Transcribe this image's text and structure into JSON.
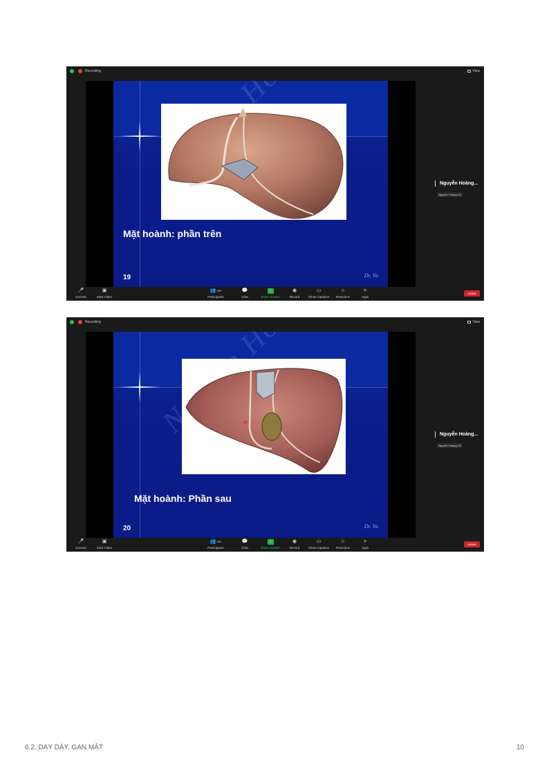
{
  "zoom_windows": [
    {
      "status": {
        "recording_label": "Recording",
        "view_label": "View"
      },
      "slide": {
        "title": "Mặt hoành: phần trên",
        "number": "19",
        "signature": "Dr. Vu",
        "watermark": "Nguyễn Hoàng Vũ"
      },
      "participant": {
        "name": "Nguyễn Hoàng...",
        "tag": "Nguyễn Hoàng Vũ"
      },
      "toolbar": {
        "unmute": "Unmute",
        "start_video": "Start Video",
        "participants": "Participants",
        "participants_count": "259",
        "chat": "Chat",
        "share_screen": "Share Screen",
        "record": "Record",
        "show_captions": "Show Captions",
        "reactions": "Reactions",
        "apps": "Apps",
        "leave": "Leave"
      }
    },
    {
      "status": {
        "recording_label": "Recording",
        "view_label": "View"
      },
      "slide": {
        "title": "Mặt hoành: Phần sau",
        "number": "20",
        "signature": "Dr. Vu",
        "watermark": "Nguyễn Hoàng Vũ"
      },
      "participant": {
        "name": "Nguyễn Hoàng...",
        "tag": "Nguyễn Hoàng Vũ"
      },
      "toolbar": {
        "unmute": "Unmute",
        "start_video": "Start Video",
        "participants": "Participants",
        "participants_count": "259",
        "chat": "Chat",
        "share_screen": "Share Screen",
        "record": "Record",
        "show_captions": "Show Captions",
        "reactions": "Reactions",
        "apps": "Apps",
        "leave": "Leave"
      }
    }
  ],
  "footer": {
    "section": "6.2. DẠY DÀY, GAN MẬT",
    "page_number": "10"
  },
  "colors": {
    "slide_blue": "#0a1f8c",
    "leave_red": "#c8262c",
    "share_green": "#22b14c",
    "recording_red": "#e8433a"
  }
}
